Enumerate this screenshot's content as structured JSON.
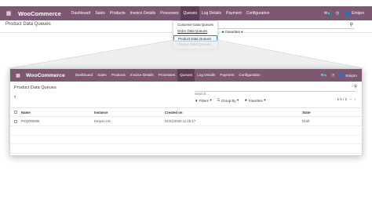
{
  "background_app": {
    "apps_icon": "grid-icon",
    "brand": "WooCommerce",
    "menu": [
      "Dashboard",
      "Sales",
      "Products",
      "Invoice Details",
      "Processes",
      "Queues",
      "Log Details",
      "Payment",
      "Configuration"
    ],
    "active_menu": "Queues",
    "chat_icon": "chat-icon",
    "chat_badge": "5",
    "clock_icon": "clock-icon",
    "user": "Emipro",
    "page_title": "Product Data Queues",
    "favorites_label": "Favorites"
  },
  "queues_dropdown": {
    "items": [
      "Customer Data Queues",
      "Order Data Queues",
      "Product Data Queues",
      "Coupon Data Queues"
    ],
    "highlighted": "Product Data Queues"
  },
  "foreground_app": {
    "apps_icon": "grid-icon",
    "brand": "WooCommerce",
    "menu": [
      "Dashboard",
      "Sales",
      "Products",
      "Invoice Details",
      "Processes",
      "Queues",
      "Log Details",
      "Payment",
      "Configuration"
    ],
    "active_menu": "Queues",
    "chat_icon": "chat-icon",
    "chat_badge": "5",
    "clock_icon": "clock-icon",
    "user": "Emipro",
    "page_title": "Product Data Queues",
    "search_placeholder": "Search...",
    "import_icon": "import-icon",
    "filters_label": "Filters",
    "group_by_label": "Group By",
    "favorites_label": "Favorites",
    "pager": "1-1 / 1",
    "table": {
      "columns": [
        "Name",
        "Instance",
        "Created on",
        "State"
      ],
      "rows": [
        {
          "name": "PSQ000006",
          "instance": "Emipro US",
          "created_on": "01/01/2020 11:18:17",
          "state": "Draft"
        }
      ]
    }
  },
  "colors": {
    "navbar": "#7c5873",
    "navbar_active": "#5e3f57",
    "highlight_border": "#2a86c7",
    "avatar": "#2b6fb8"
  }
}
